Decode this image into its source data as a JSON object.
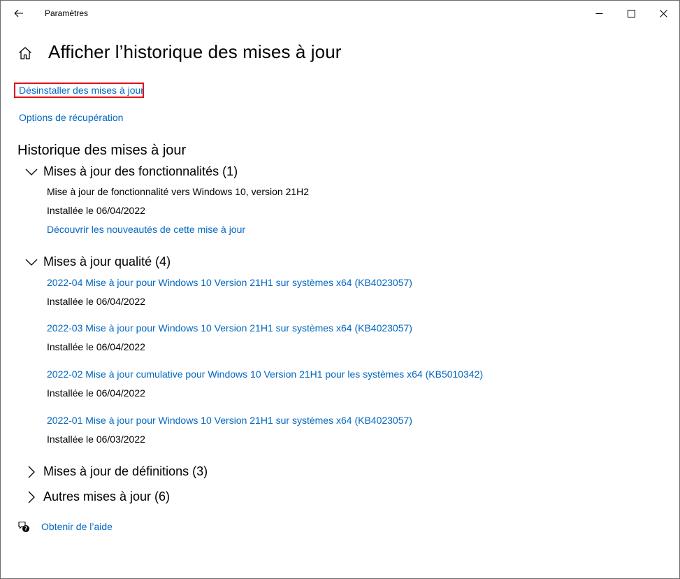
{
  "titlebar": {
    "app_title": "Paramètres"
  },
  "page": {
    "title": "Afficher l’historique des mises à jour"
  },
  "links": {
    "uninstall": "Désinstaller des mises à jour",
    "recovery": "Options de récupération",
    "help": "Obtenir de l’aide"
  },
  "history": {
    "title": "Historique des mises à jour",
    "feature": {
      "label": "Mises à jour des fonctionnalités (1)",
      "expanded": true,
      "item_title": "Mise à jour de fonctionnalité vers Windows 10, version 21H2",
      "item_date": "Installée le 06/04/2022",
      "item_link": "Découvrir les nouveautés de cette mise à jour"
    },
    "quality": {
      "label": "Mises à jour qualité (4)",
      "expanded": true,
      "items": [
        {
          "title": "2022-04 Mise à jour pour Windows 10 Version 21H1 sur systèmes x64 (KB4023057)",
          "date": "Installée le 06/04/2022"
        },
        {
          "title": "2022-03 Mise à jour pour Windows 10 Version 21H1 sur systèmes x64 (KB4023057)",
          "date": "Installée le 06/04/2022"
        },
        {
          "title": "2022-02 Mise à jour cumulative pour Windows 10 Version 21H1 pour les systèmes x64 (KB5010342)",
          "date": "Installée le 06/04/2022"
        },
        {
          "title": "2022-01 Mise à jour pour Windows 10 Version 21H1 sur systèmes x64 (KB4023057)",
          "date": "Installée le 06/03/2022"
        }
      ]
    },
    "definitions": {
      "label": "Mises à jour de définitions (3)",
      "expanded": false
    },
    "other": {
      "label": "Autres mises à jour (6)",
      "expanded": false
    }
  },
  "colors": {
    "link": "#0067c0",
    "highlight_box": "#e0101a"
  },
  "icons": {
    "back": "back-arrow-icon",
    "home": "home-icon",
    "help": "help-chat-icon",
    "expanded": "chevron-down-icon",
    "collapsed": "chevron-right-icon"
  }
}
